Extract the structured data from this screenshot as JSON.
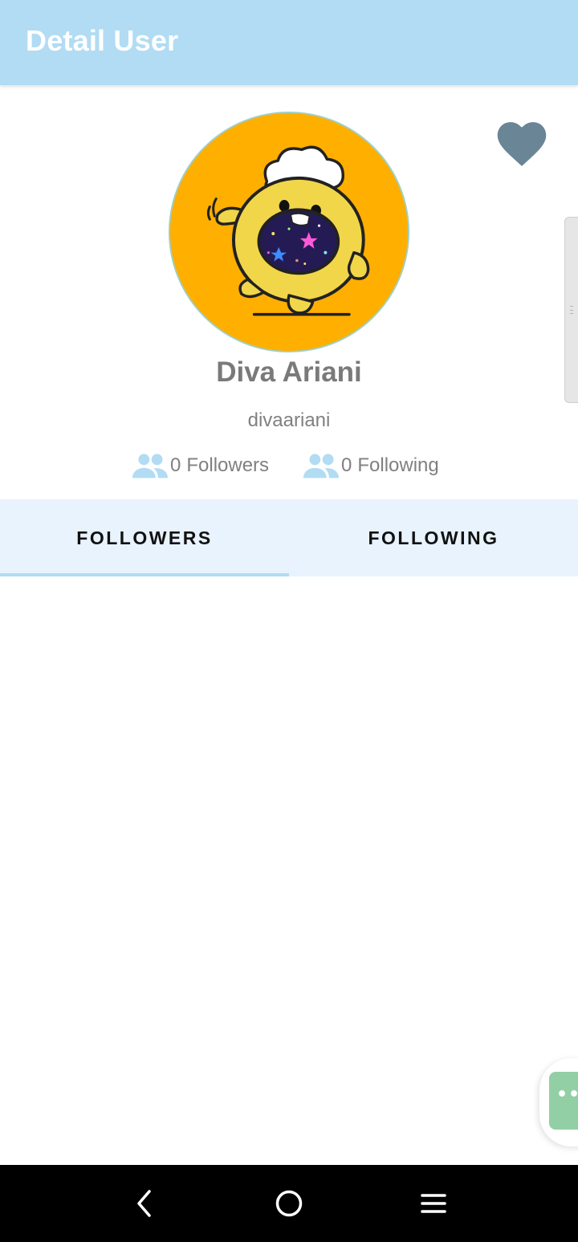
{
  "app_bar": {
    "title": "Detail User"
  },
  "favorite": {
    "icon": "heart-icon",
    "color": "#6a8595"
  },
  "user": {
    "name": "Diva Ariani",
    "login": "divaariani",
    "avatar_icon": "avatar-image"
  },
  "stats": {
    "followers_count": "0",
    "followers_label": "Followers",
    "following_count": "0",
    "following_label": "Following",
    "icon": "people-icon",
    "icon_color": "#b1dcf3"
  },
  "tabs": [
    {
      "label": "FOLLOWERS",
      "active": true
    },
    {
      "label": "FOLLOWING",
      "active": false
    }
  ],
  "colors": {
    "app_bar": "#b1dcf3",
    "tab_bar": "#e8f3fd",
    "tab_indicator": "#b1dcf3",
    "text_secondary": "#808080",
    "fab": "#93cfa4"
  },
  "fab": {
    "icon": "more-dots-icon"
  },
  "nav_bar": {
    "back_icon": "back-icon",
    "home_icon": "home-icon",
    "menu_icon": "menu-icon"
  }
}
